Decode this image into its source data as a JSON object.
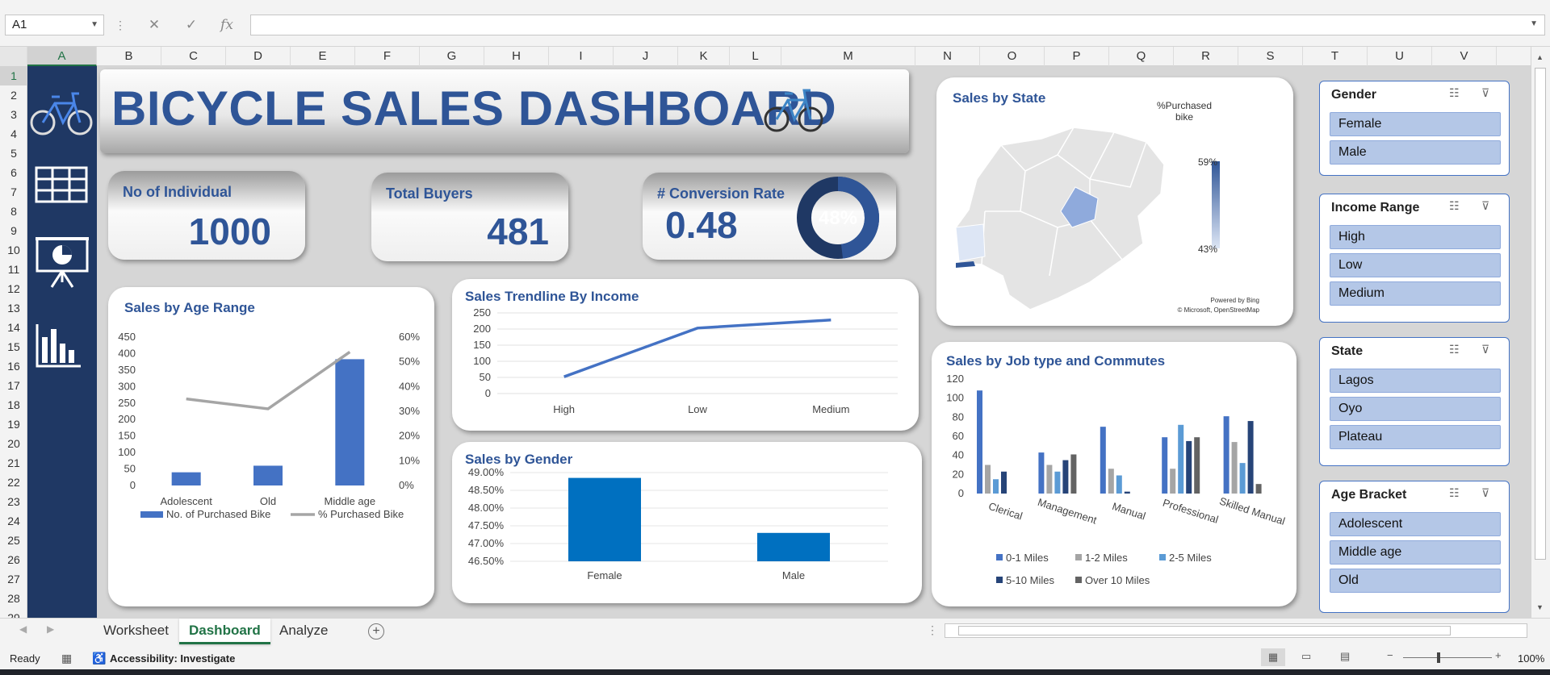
{
  "namebox": "A1",
  "columns": [
    "A",
    "B",
    "C",
    "D",
    "E",
    "F",
    "G",
    "H",
    "I",
    "J",
    "K",
    "L",
    "M",
    "N",
    "O",
    "P",
    "Q",
    "R",
    "S",
    "T",
    "U",
    "V"
  ],
  "rows": [
    "1",
    "2",
    "3",
    "4",
    "5",
    "6",
    "7",
    "8",
    "9",
    "10",
    "11",
    "12",
    "13",
    "14",
    "15",
    "16",
    "17",
    "18",
    "19",
    "20",
    "21",
    "22",
    "23",
    "24",
    "25",
    "26",
    "27",
    "28",
    "29"
  ],
  "title": "BICYCLE SALES DASHBOARD",
  "kpis": {
    "individuals": {
      "label": "No of Individual",
      "value": "1000"
    },
    "buyers": {
      "label": "Total Buyers",
      "value": "481"
    },
    "conversion": {
      "label": "# Conversion Rate",
      "value": "0.48",
      "donut": "48%",
      "fraction": 0.48
    }
  },
  "map": {
    "title": "Sales by State",
    "legend_title_1": "%Purchased",
    "legend_title_2": "bike",
    "legend_max": "59%",
    "legend_min": "43%",
    "credit_1": "Powered by Bing",
    "credit_2": "© Microsoft, OpenStreetMap"
  },
  "slicers": [
    {
      "title": "Gender",
      "items": [
        "Female",
        "Male"
      ]
    },
    {
      "title": "Income Range",
      "items": [
        "High",
        "Low",
        "Medium"
      ]
    },
    {
      "title": "State",
      "items": [
        "Lagos",
        "Oyo",
        "Plateau"
      ]
    },
    {
      "title": "Age Bracket",
      "items": [
        "Adolescent",
        "Middle age",
        "Old"
      ]
    }
  ],
  "tabs": [
    "Worksheet",
    "Dashboard",
    "Analyze"
  ],
  "active_tab": "Dashboard",
  "status": {
    "ready": "Ready",
    "accessibility": "Accessibility: Investigate",
    "zoom": "100%"
  },
  "colors": {
    "accent": "#2f5597",
    "sidebar": "#1f3864",
    "bar": "#4472c4",
    "bar_gender": "#0070c0"
  },
  "chart_data": [
    {
      "type": "bar",
      "title": "Sales by Age Range",
      "categories": [
        "Adolescent",
        "Old",
        "Middle age"
      ],
      "series": [
        {
          "name": "No. of Purchased Bike",
          "values": [
            40,
            60,
            383
          ],
          "axis": "left"
        },
        {
          "name": "% Purchased Bike",
          "values": [
            0.35,
            0.31,
            0.54
          ],
          "axis": "right",
          "render": "line"
        }
      ],
      "ylim": [
        0,
        450
      ],
      "y_ticks": [
        "0",
        "50",
        "100",
        "150",
        "200",
        "250",
        "300",
        "350",
        "400",
        "450"
      ],
      "y2lim": [
        0,
        0.6
      ],
      "y2_ticks": [
        "0%",
        "10%",
        "20%",
        "30%",
        "40%",
        "50%",
        "60%"
      ],
      "legend": "bottom"
    },
    {
      "type": "line",
      "title": "Sales Trendline By Income",
      "categories": [
        "High",
        "Low",
        "Medium"
      ],
      "values": [
        52,
        203,
        228
      ],
      "ylim": [
        0,
        250
      ],
      "y_ticks": [
        "0",
        "50",
        "100",
        "150",
        "200",
        "250"
      ]
    },
    {
      "type": "bar",
      "title": "Sales by Gender",
      "categories": [
        "Female",
        "Male"
      ],
      "values": [
        0.4885,
        0.473
      ],
      "ylim": [
        0.465,
        0.49
      ],
      "y_ticks": [
        "46.50%",
        "47.00%",
        "47.50%",
        "48.00%",
        "48.50%",
        "49.00%"
      ]
    },
    {
      "type": "bar",
      "title": "Sales by Job type and Commutes",
      "categories": [
        "Clerical",
        "Management",
        "Manual",
        "Professional",
        "Skilled Manual"
      ],
      "series": [
        {
          "name": "0-1 Miles",
          "values": [
            108,
            43,
            70,
            59,
            81
          ],
          "color": "#4472c4"
        },
        {
          "name": "1-2 Miles",
          "values": [
            30,
            30,
            26,
            26,
            54
          ],
          "color": "#a5a5a5"
        },
        {
          "name": "2-5 Miles",
          "values": [
            15,
            23,
            19,
            72,
            32
          ],
          "color": "#5b9bd5"
        },
        {
          "name": "5-10 Miles",
          "values": [
            23,
            35,
            2,
            55,
            76
          ],
          "color": "#264478"
        },
        {
          "name": "Over 10 Miles",
          "values": [
            0,
            41,
            0,
            59,
            10
          ],
          "color": "#636363"
        }
      ],
      "ylim": [
        0,
        120
      ],
      "y_ticks": [
        "0",
        "20",
        "40",
        "60",
        "80",
        "100",
        "120"
      ],
      "legend": "bottom"
    }
  ]
}
